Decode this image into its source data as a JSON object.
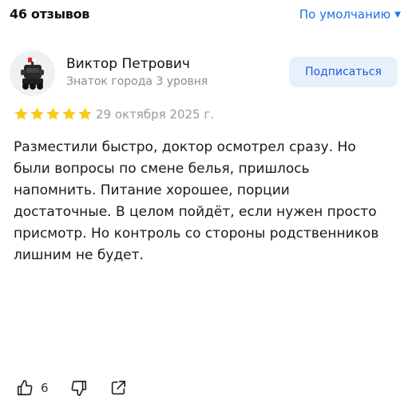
{
  "header": {
    "reviews_count": "46 отзывов",
    "sort_label": "По умолчанию",
    "sort_chevron": "▼"
  },
  "review": {
    "author": {
      "name": "Виктор Петрович",
      "level": "Знаток города 3 уровня",
      "avatar_icon": "robot-avatar-icon"
    },
    "subscribe_label": "Подписаться",
    "rating": 5,
    "rating_max": 5,
    "date": "29 октября 2025 г.",
    "text": "Разместили быстро, доктор осмотрел сразу. Но были вопросы по смене белья, пришлось напомнить. Питание хорошее, порции достаточные. В целом пойдёт, если нужен просто присмотр. Но контроль со стороны родственников лишним не будет.",
    "likes": "6"
  },
  "colors": {
    "accent": "#1a73e8",
    "star": "#fac917",
    "subscribe_bg": "#e8f0fc",
    "muted": "#9a9a9a"
  },
  "icons": {
    "like": "thumbs-up-icon",
    "dislike": "thumbs-down-icon",
    "share": "share-icon",
    "star": "star-icon"
  }
}
